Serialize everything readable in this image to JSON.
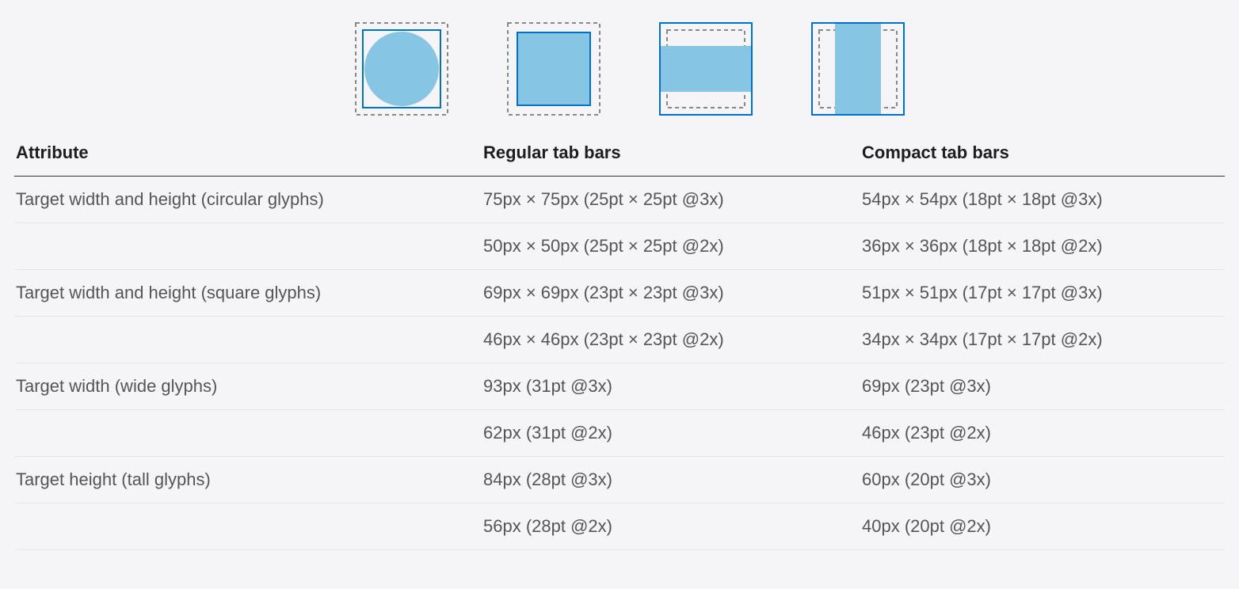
{
  "headers": {
    "attribute": "Attribute",
    "regular": "Regular tab bars",
    "compact": "Compact tab bars"
  },
  "rows": [
    {
      "attr": "Target width and height (circular glyphs)",
      "regular": "75px × 75px (25pt × 25pt @3x)",
      "compact": "54px × 54px (18pt × 18pt @3x)"
    },
    {
      "attr": "",
      "regular": "50px × 50px (25pt × 25pt @2x)",
      "compact": "36px × 36px (18pt × 18pt @2x)"
    },
    {
      "attr": "Target width and height (square glyphs)",
      "regular": "69px × 69px (23pt × 23pt @3x)",
      "compact": "51px × 51px (17pt × 17pt @3x)"
    },
    {
      "attr": "",
      "regular": "46px × 46px (23pt × 23pt @2x)",
      "compact": "34px × 34px (17pt × 17pt @2x)"
    },
    {
      "attr": "Target width (wide glyphs)",
      "regular": "93px (31pt @3x)",
      "compact": "69px (23pt @3x)"
    },
    {
      "attr": "",
      "regular": "62px (31pt @2x)",
      "compact": "46px (23pt @2x)"
    },
    {
      "attr": "Target height (tall glyphs)",
      "regular": "84px (28pt @3x)",
      "compact": "60px (20pt @3x)"
    },
    {
      "attr": "",
      "regular": "56px (28pt @2x)",
      "compact": "40px (20pt @2x)"
    }
  ],
  "colors": {
    "blue": "#0070c9",
    "fill": "#86c6e4",
    "gray": "#888888"
  }
}
